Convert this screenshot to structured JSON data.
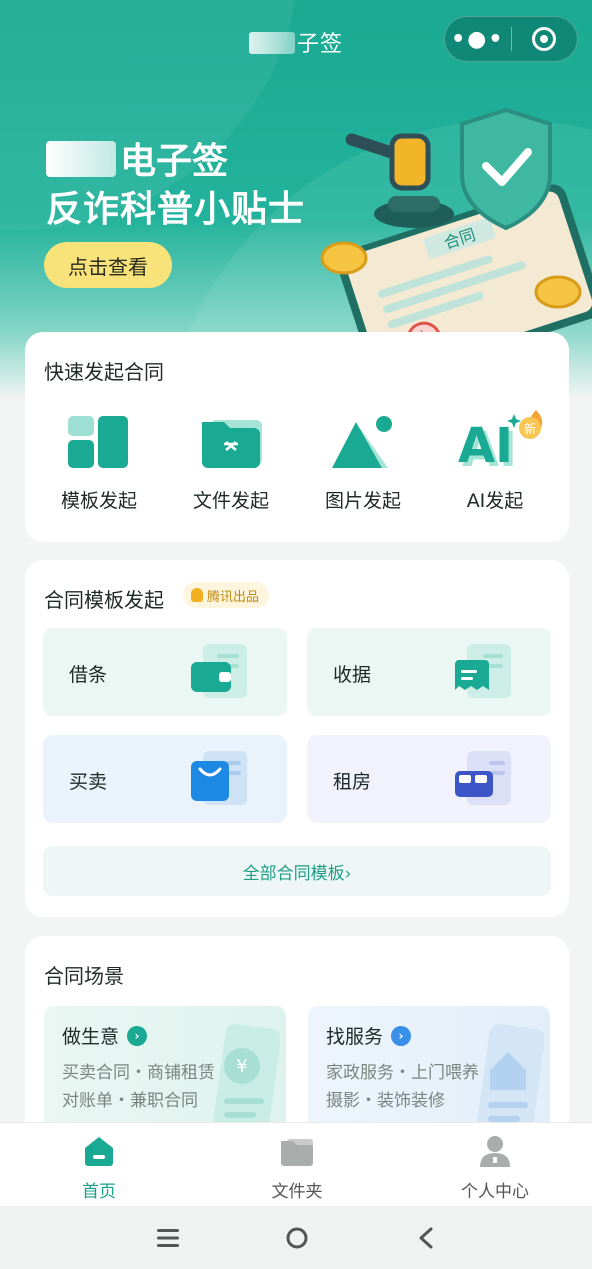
{
  "nav": {
    "title_suffix": "子签"
  },
  "hero": {
    "title_line1_suffix": "电子签",
    "title_line2": "反诈科普小贴士",
    "button_label": "点击查看",
    "stamp_text": "合同"
  },
  "quick": {
    "title": "快速发起合同",
    "items": [
      {
        "label": "模板发起",
        "icon": "template-icon"
      },
      {
        "label": "文件发起",
        "icon": "folder-icon"
      },
      {
        "label": "图片发起",
        "icon": "image-icon"
      },
      {
        "label": "AI发起",
        "icon": "ai-icon",
        "badge": "新"
      }
    ]
  },
  "templates": {
    "title": "合同模板发起",
    "badge": "腾讯出品",
    "tiles": [
      {
        "label": "借条",
        "icon": "wallet-icon"
      },
      {
        "label": "收据",
        "icon": "receipt-icon"
      },
      {
        "label": "买卖",
        "icon": "shopping-bag-icon"
      },
      {
        "label": "租房",
        "icon": "bed-icon"
      }
    ],
    "all_label": "全部合同模板›"
  },
  "scenes": {
    "title": "合同场景",
    "cards": [
      {
        "title": "做生意",
        "line1": "买卖合同・商铺租赁",
        "line2": "对账单・兼职合同",
        "arrow_color": "#1aaa93"
      },
      {
        "title": "找服务",
        "line1": "家政服务・上门喂养",
        "line2": "摄影・装饰装修",
        "arrow_color": "#3a8fe8"
      }
    ]
  },
  "tabbar": {
    "tabs": [
      {
        "label": "首页",
        "active": true
      },
      {
        "label": "文件夹",
        "active": false
      },
      {
        "label": "个人中心",
        "active": false
      }
    ]
  },
  "colors": {
    "brand": "#1aaa93",
    "accent_yellow": "#f8e27a"
  }
}
